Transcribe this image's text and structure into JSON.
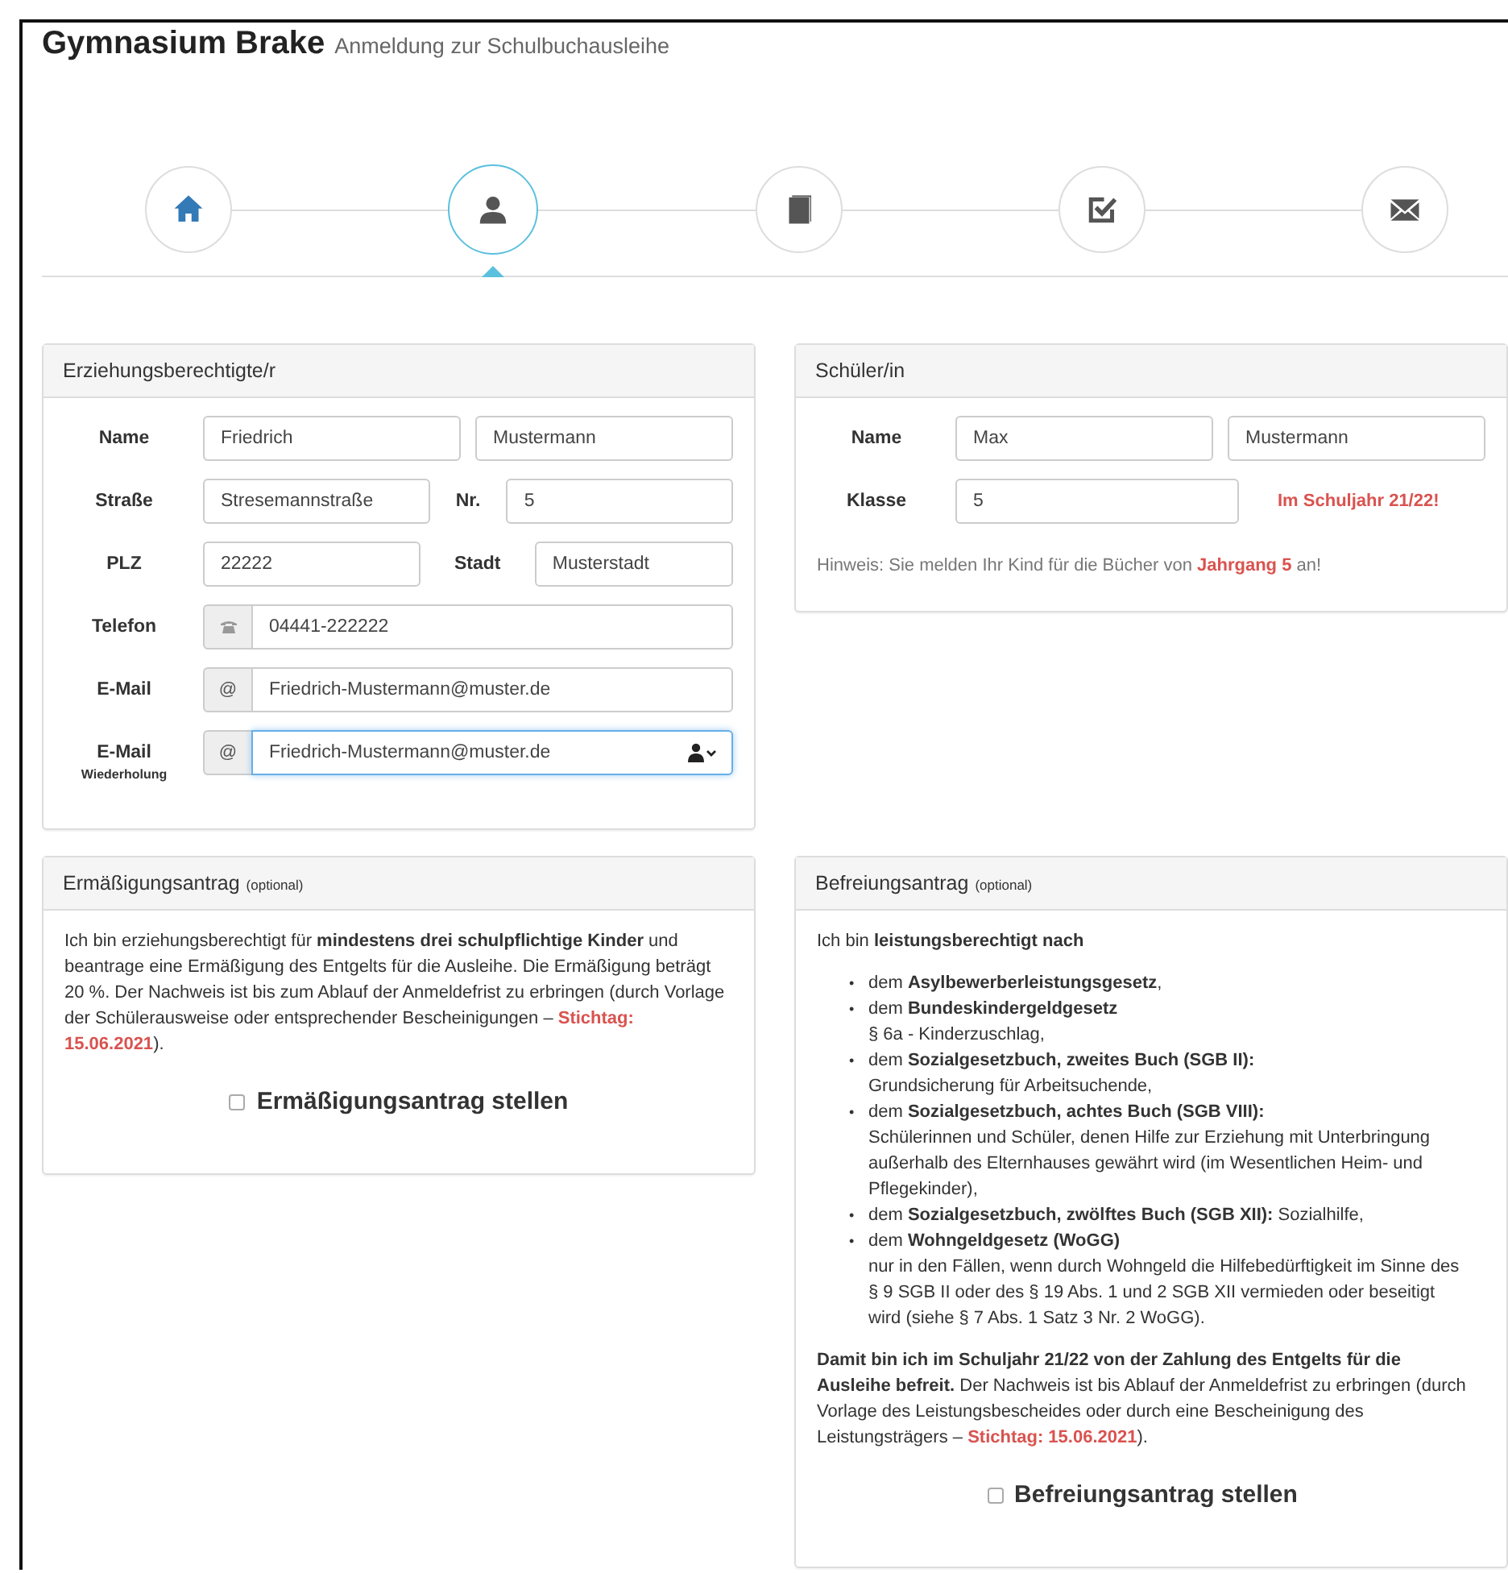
{
  "header": {
    "title": "Gymnasium Brake",
    "subtitle": "Anmeldung zur Schulbuchausleihe"
  },
  "steps": [
    {
      "selected": false,
      "completed": true
    },
    {
      "selected": true,
      "completed": false
    },
    {
      "selected": false,
      "completed": false
    },
    {
      "selected": false,
      "completed": false
    },
    {
      "selected": false,
      "completed": false
    }
  ],
  "guardian": {
    "title": "Erziehungsberechtigte/r",
    "rows": [
      {
        "kind": "pair",
        "label": "Name",
        "values": [
          "Friedrich",
          "Mustermann"
        ]
      },
      {
        "kind": "street",
        "label": "Straße",
        "value": "Stresemannstraße",
        "label_2": "Nr.",
        "value_2": "5"
      },
      {
        "kind": "city",
        "label": "PLZ",
        "value": "22222",
        "label_2": "Stadt",
        "value_2": "Musterstadt"
      },
      {
        "kind": "addon",
        "label": "Telefon",
        "value": "04441-222222",
        "focused": false
      },
      {
        "kind": "addon",
        "label": "E-Mail",
        "addon_text": "@",
        "value": "Friedrich-Mustermann@muster.de",
        "focused": false
      },
      {
        "kind": "addon",
        "label": "E-Mail",
        "sublabel": "Wiederholung",
        "addon_text": "@",
        "value": "Friedrich-Mustermann@muster.de",
        "focused": true
      }
    ]
  },
  "student": {
    "title": "Schüler/in",
    "rows": [
      {
        "kind": "pair",
        "label": "Name",
        "values": [
          "Max",
          "Mustermann"
        ]
      },
      {
        "kind": "class",
        "label": "Klasse",
        "value": "5",
        "note": "Im Schuljahr 21/22!"
      }
    ],
    "hint": [
      {
        "kind": "text",
        "text": "Hinweis: Sie melden Ihr Kind für die Bücher von "
      },
      {
        "kind": "red",
        "text": "Jahrgang 5"
      },
      {
        "kind": "text",
        "text": " an!"
      }
    ]
  },
  "reduction": {
    "title": "Ermäßigungsantrag",
    "tag": "(optional)",
    "paragraph": [
      {
        "kind": "text",
        "text": "Ich bin erziehungsberechtigt für **mindestens drei schulpflichtige Kinder** und beantrage eine Ermäßigung des Entgelts für die Ausleihe. Die Ermäßigung beträgt 20 %. Der Nachweis ist bis zum Ablauf der Anmeldefrist zu erbringen (durch Vorlage der Schülerausweise oder entsprechender Bescheinigungen – "
      },
      {
        "kind": "red",
        "text": "Stichtag: 15.06.2021"
      },
      {
        "kind": "text",
        "text": ")."
      }
    ],
    "checkbox": {
      "label": "Ermäßigungsantrag stellen",
      "checked": false
    }
  },
  "exemption": {
    "title": "Befreiungsantrag",
    "tag": "(optional)",
    "intro": "Ich bin **leistungsberechtigt nach**",
    "items": [
      {
        "bullet": "•",
        "text": "dem **Asylbewerberleistungsgesetz**,"
      },
      {
        "bullet": "•",
        "text": "dem **Bundeskindergeldgesetz**",
        "detail": "§ 6a - Kinderzuschlag,"
      },
      {
        "bullet": "•",
        "text": "dem **Sozialgesetzbuch, zweites Buch (SGB II):**",
        "detail": "Grundsicherung für Arbeitsuchende,"
      },
      {
        "bullet": "•",
        "text": "dem **Sozialgesetzbuch, achtes Buch (SGB VIII):**",
        "detail": "Schülerinnen und Schüler, denen Hilfe zur Erziehung mit Unterbringung außerhalb des Elternhauses gewährt wird (im Wesentlichen Heim- und Pflegekinder),"
      },
      {
        "bullet": "•",
        "text": "dem **Sozialgesetzbuch, zwölftes Buch (SGB XII):** Sozialhilfe,"
      },
      {
        "bullet": "•",
        "text": "dem **Wohngeldgesetz (WoGG)**",
        "detail": "nur in den Fällen, wenn durch Wohngeld die Hilfebedürftigkeit im Sinne des § 9 SGB II oder des § 19 Abs. 1 und 2 SGB XII vermieden oder beseitigt wird (siehe § 7 Abs. 1 Satz 3 Nr. 2 WoGG)."
      }
    ],
    "paragraph": [
      {
        "kind": "text",
        "text": "**Damit bin ich im Schuljahr 21/22 von der Zahlung des Entgelts für die Ausleihe befreit.** Der Nachweis ist bis Ablauf der Anmeldefrist zu erbringen (durch Vorlage des Leistungsbescheides oder durch eine Bescheinigung des Leistungsträgers – "
      },
      {
        "kind": "red",
        "text": "Stichtag: 15.06.2021"
      },
      {
        "kind": "text",
        "text": ")."
      }
    ],
    "checkbox": {
      "label": "Befreiungsantrag stellen",
      "checked": false
    }
  }
}
